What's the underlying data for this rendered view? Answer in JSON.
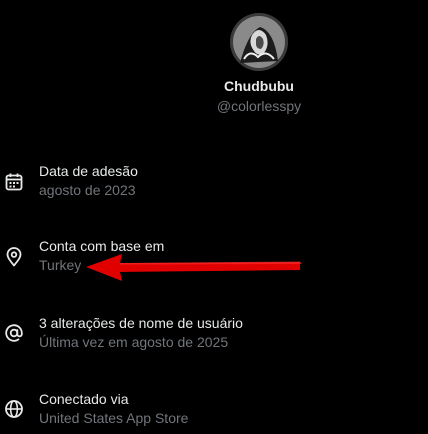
{
  "profile": {
    "display_name": "Chudbubu",
    "handle": "@colorlesspy"
  },
  "about": {
    "items": [
      {
        "icon": "calendar-icon",
        "title": "Data de adesão",
        "detail": "agosto de 2023"
      },
      {
        "icon": "location-pin-icon",
        "title": "Conta com base em",
        "detail": "Turkey"
      },
      {
        "icon": "at-sign-icon",
        "title": "3 alterações de nome de usuário",
        "detail": "Última vez em agosto de 2025"
      },
      {
        "icon": "globe-icon",
        "title": "Conectado via",
        "detail": "United States App Store"
      }
    ]
  },
  "colors": {
    "background": "#000000",
    "primary_text": "#e7e9ea",
    "secondary_text": "#71767b",
    "annotation_arrow": "#e00000"
  }
}
